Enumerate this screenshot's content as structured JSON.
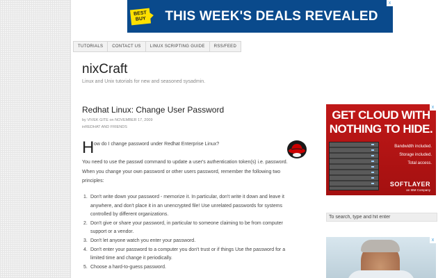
{
  "top_ad": {
    "brand": "BEST BUY",
    "headline": "THIS WEEK'S DEALS REVEALED",
    "choice_icon": "x"
  },
  "nav": {
    "items": [
      "TUTORIALS",
      "CONTACT US",
      "LINUX SCRIPTING GUIDE",
      "RSS/FEED"
    ]
  },
  "site": {
    "title": "nixCraft",
    "tagline": "Linux and Unix tutorials for new and seasoned sysadmin."
  },
  "post": {
    "title": "Redhat Linux: Change User Password",
    "meta_by": "by",
    "author": "VIVEK GITE",
    "meta_on": "on",
    "date": "NOVEMBER 17, 2009",
    "meta_in": "in",
    "category": "REDHAT AND FRIENDS",
    "dropcap": "H",
    "intro": "ow do I change password under Redhat Enterprise Linux?",
    "paragraph": "You need to use the passwd command to update a user's authentication token(s) i.e. password. When you change your own password or other users password, remember the following two principles:",
    "principles": [
      {
        "num": "1.",
        "text": "Don't write down your password - memorize it. In particular, don't write it down and leave it anywhere, and don't place it in an unencrypted file! Use unrelated passwords for systems controlled by different organizations."
      },
      {
        "num": "2.",
        "text": "Don't give or share your password, in particular to someone claiming to be from computer support or a vendor."
      },
      {
        "num": "3.",
        "text": "Don't let anyone watch you enter your password."
      },
      {
        "num": "4.",
        "text": "Don't enter your password to a computer you don't trust or if things Use the password for a limited time and change it periodically."
      },
      {
        "num": "5.",
        "text": "Choose a hard-to-guess password."
      }
    ],
    "logo_icon": "redhat-shadowman-icon"
  },
  "sidebar": {
    "ad1": {
      "headline_line1": "GET CLOUD WITH",
      "headline_line2": "NOTHING TO HIDE.",
      "line1": "Bandwidth included.",
      "line2": "Storage included.",
      "line3": "Total access.",
      "brand": "SOFTLAYER",
      "brand_sub": "an IBM Company",
      "choice_icon": "x"
    },
    "search": {
      "placeholder": "To search, type and hit enter"
    },
    "ad2": {
      "choice_icon": "x"
    }
  },
  "colors": {
    "ad_blue": "#0a4a8c",
    "ad_red": "#c01818",
    "bestbuy_yellow": "#ffe000"
  }
}
